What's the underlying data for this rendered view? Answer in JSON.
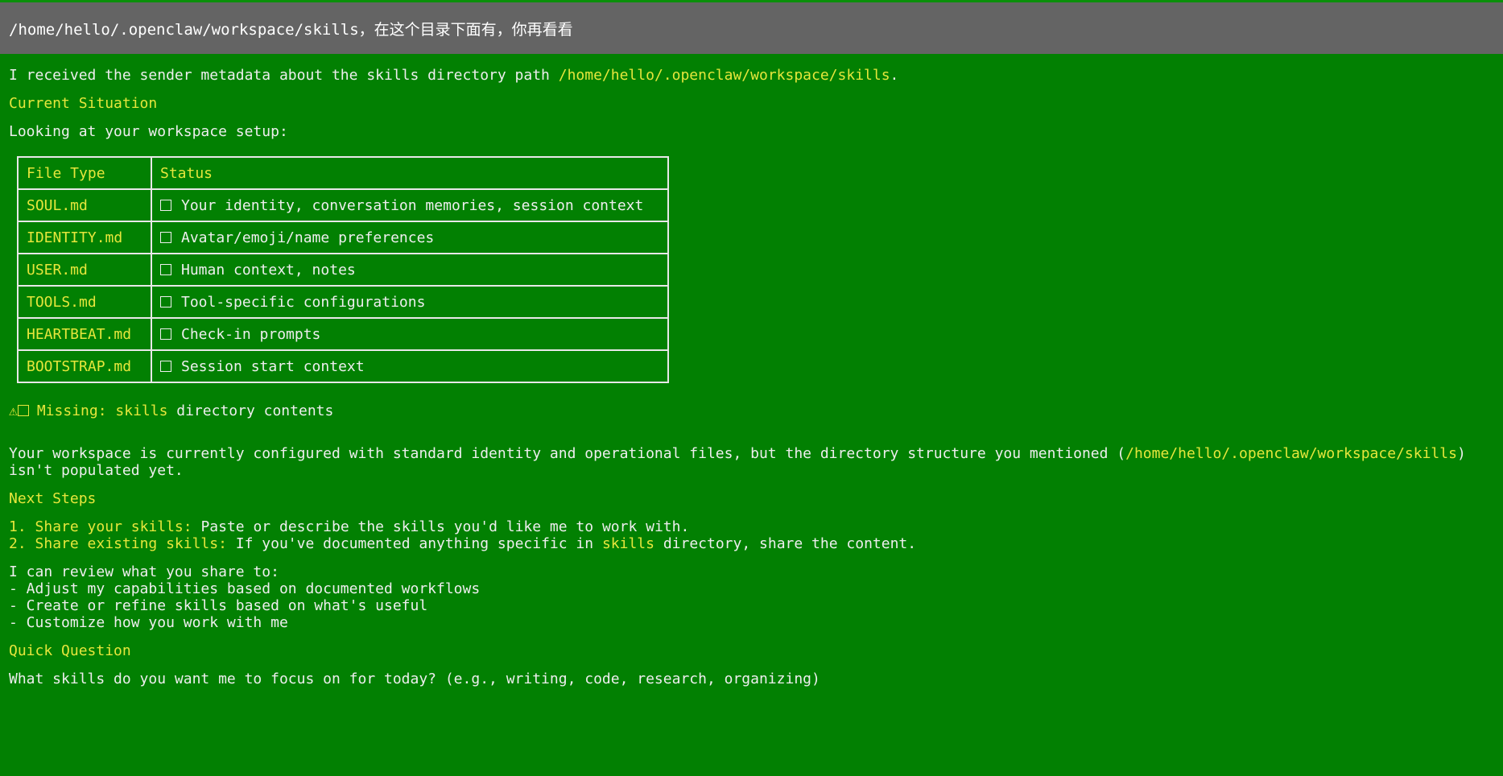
{
  "user_message": "/home/hello/.openclaw/workspace/skills，在这个目录下面有，你再看看",
  "intro": {
    "prefix": "I received the sender metadata about the skills directory path ",
    "path": "/home/hello/.openclaw/workspace/skills",
    "suffix": "."
  },
  "current_situation": {
    "heading": "Current Situation",
    "lead": "Looking at your workspace setup:"
  },
  "table": {
    "headers": [
      "File Type",
      "Status"
    ],
    "rows": [
      {
        "file": "SOUL.md",
        "status": "Your identity, conversation memories, session context"
      },
      {
        "file": "IDENTITY.md",
        "status": "Avatar/emoji/name preferences"
      },
      {
        "file": "USER.md",
        "status": "Human context, notes"
      },
      {
        "file": "TOOLS.md",
        "status": "Tool-specific configurations"
      },
      {
        "file": "HEARTBEAT.md",
        "status": "Check-in prompts"
      },
      {
        "file": "BOOTSTRAP.md",
        "status": "Session start context"
      }
    ]
  },
  "warning": {
    "icon": "⚠",
    "label": "Missing:",
    "keyword": "skills",
    "rest": " directory contents"
  },
  "explanation": {
    "prefix": "Your workspace is currently configured with standard identity and operational files, but the directory structure you mentioned (",
    "path": "/home/hello/.openclaw/workspace/skills",
    "suffix": ")",
    "line2": "isn't populated yet."
  },
  "next_steps": {
    "heading": "Next Steps",
    "items": [
      {
        "num": "1.",
        "label": "Share your skills:",
        "text": " Paste or describe the skills you'd like me to work with.",
        "keyword": "",
        "tail": ""
      },
      {
        "num": "2.",
        "label": "Share existing skills:",
        "text": " If you've documented anything specific in ",
        "keyword": "skills",
        "tail": " directory, share the content."
      }
    ]
  },
  "review": {
    "lead": "I can review what you share to:",
    "items": [
      "- Adjust my capabilities based on documented workflows",
      "- Create or refine skills based on what's useful",
      "- Customize how you work with me"
    ]
  },
  "quick_question": {
    "heading": "Quick Question",
    "text": "What skills do you want me to focus on for today? (e.g., writing, code, research, organizing)"
  },
  "colors": {
    "background": "#028002",
    "user_bar": "#646464",
    "highlight": "#e6e63c",
    "text": "#eeeeee"
  }
}
